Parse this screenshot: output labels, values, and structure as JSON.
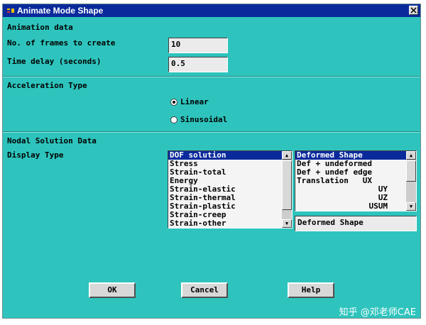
{
  "window": {
    "title": "Animate Mode Shape",
    "close_icon": "close-icon"
  },
  "animation": {
    "heading": "Animation data",
    "frames_label": "No. of frames to create",
    "frames_value": "10",
    "delay_label": "Time delay (seconds)",
    "delay_value": "0.5"
  },
  "acceleration": {
    "heading": "Acceleration Type",
    "options": [
      {
        "label": "Linear",
        "selected": true
      },
      {
        "label": "Sinusoidal",
        "selected": false
      }
    ]
  },
  "nodal": {
    "heading": "Nodal Solution Data",
    "display_label": "Display Type",
    "category_list": [
      "DOF solution",
      "Stress",
      "Strain-total",
      "Energy",
      "Strain-elastic",
      "Strain-thermal",
      "Strain-plastic",
      "Strain-creep",
      "Strain-other"
    ],
    "category_selected": "DOF solution",
    "item_list": [
      "Deformed Shape",
      "Def + undeformed",
      "Def + undef edge",
      "Translation   UX",
      "UY",
      "UZ",
      "USUM"
    ],
    "item_selected": "Deformed Shape",
    "item_field_value": "Deformed Shape"
  },
  "buttons": {
    "ok": "OK",
    "cancel": "Cancel",
    "help": "Help"
  },
  "watermark": "知乎 @邓老师CAE",
  "colors": {
    "dialog_bg": "#2ec4bd",
    "titlebar": "#0a2a9c",
    "selection": "#0a2a9c"
  }
}
